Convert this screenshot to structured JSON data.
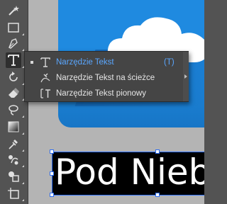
{
  "flyout": {
    "items": [
      {
        "label": "Narzędzie Tekst",
        "shortcut": "(T)",
        "selected": true,
        "icon": "type-icon"
      },
      {
        "label": "Narzędzie Tekst na ścieżce",
        "shortcut": "",
        "selected": false,
        "icon": "type-on-path-icon"
      },
      {
        "label": "Narzędzie Tekst pionowy",
        "shortcut": "",
        "selected": false,
        "icon": "vertical-type-icon"
      }
    ]
  },
  "canvas": {
    "text": "Pod Niebo",
    "accent_color": "#1f8ae0",
    "selection_color": "#2d6ef5"
  },
  "toolbar": {
    "tools": [
      "magic-wand-icon",
      "rectangle-icon",
      "pen-icon",
      "type-icon",
      "rotate-icon",
      "eraser-icon",
      "lasso-icon",
      "gradient-icon",
      "eyedropper-icon",
      "blend-icon",
      "shape-builder-icon",
      "artboard-icon"
    ],
    "active": "type-icon"
  }
}
